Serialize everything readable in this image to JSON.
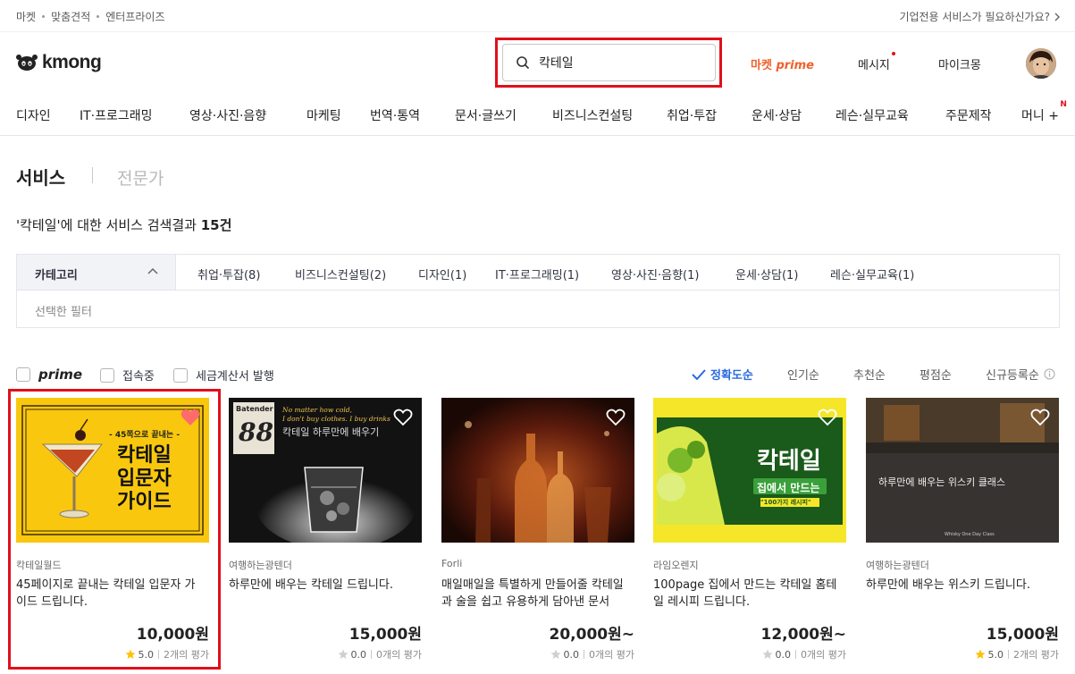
{
  "utilbar": {
    "left_items": [
      "마켓",
      "맞춤견적",
      "엔터프라이즈"
    ],
    "right_text": "기업전용 서비스가 필요하신가요?"
  },
  "header": {
    "logo_text": "kmong",
    "search_value": "칵테일",
    "prime_label": "마켓",
    "prime_italic": "prime",
    "message_label": "메시지",
    "mykmong_label": "마이크몽"
  },
  "categories": [
    "디자인",
    "IT·프로그래밍",
    "영상·사진·음향",
    "마케팅",
    "번역·통역",
    "문서·글쓰기",
    "비즈니스컨설팅",
    "취업·투잡",
    "운세·상담",
    "레슨·실무교육",
    "주문제작",
    "머니 +"
  ],
  "new_badge": "N",
  "tabs": {
    "service": "서비스",
    "expert": "전문가"
  },
  "result_text_prefix": "'칵테일'에 대한 서비스 검색결과 ",
  "result_count": "15건",
  "filter": {
    "category_label": "카테고리",
    "chips": [
      "취업·투잡(8)",
      "비즈니스컨설팅(2)",
      "디자인(1)",
      "IT·프로그래밍(1)",
      "영상·사진·음향(1)",
      "운세·상담(1)",
      "레슨·실무교육(1)"
    ],
    "selected_label": "선택한 필터"
  },
  "options": {
    "prime": "prime",
    "online": "접속중",
    "tax": "세금계산서 발행"
  },
  "sort": [
    "정확도순",
    "인기순",
    "추천순",
    "평점순",
    "신규등록순"
  ],
  "colors": {
    "highlight": "#e0101b",
    "prime": "#f0602c",
    "sort_active": "#2a6ae0",
    "star": "#ffc107"
  },
  "cards": [
    {
      "seller": "칵테일월드",
      "title": "45페이지로 끝내는 칵테일 입문자 가이드 드립니다.",
      "price": "10,000원",
      "score": "5.0",
      "reviews": "2개의 평가",
      "thumb_top": "- 45쪽으로 끝내는 -",
      "thumb_main": [
        "칵테일",
        "입문자",
        "가이드"
      ],
      "favorited": true
    },
    {
      "seller": "여행하는광텐더",
      "title": "하루만에 배우는 칵테일 드립니다.",
      "price": "15,000원",
      "score": "0.0",
      "reviews": "0개의 평가",
      "thumb_brand": "Batender",
      "thumb_num": "88",
      "thumb_quote": [
        "No matter how cold,",
        "I don't buy clothes. I buy drinks"
      ],
      "thumb_main": [
        "칵테일 하루만에 배우기"
      ],
      "favorited": false
    },
    {
      "seller": "Forli",
      "title": "매일매일을 특별하게 만들어줄 칵테일과 술을 쉽고 유용하게 담아낸 문서를…",
      "price": "20,000원~",
      "score": "0.0",
      "reviews": "0개의 평가",
      "favorited": false
    },
    {
      "seller": "라임오렌지",
      "title": "100page 집에서 만드는 칵테일 홈테일 레시피 드립니다.",
      "price": "12,000원~",
      "score": "0.0",
      "reviews": "0개의 평가",
      "thumb_main": [
        "칵테일",
        "집에서 만드는",
        "\"100가지 레시피\""
      ],
      "favorited": false
    },
    {
      "seller": "여행하는광텐더",
      "title": "하루만에 배우는 위스키 드립니다.",
      "price": "15,000원",
      "score": "5.0",
      "reviews": "2개의 평가",
      "thumb_main": [
        "하루만에 배우는 위스키 클래스"
      ],
      "thumb_caption": "Whisky One Day Class",
      "favorited": false
    }
  ]
}
